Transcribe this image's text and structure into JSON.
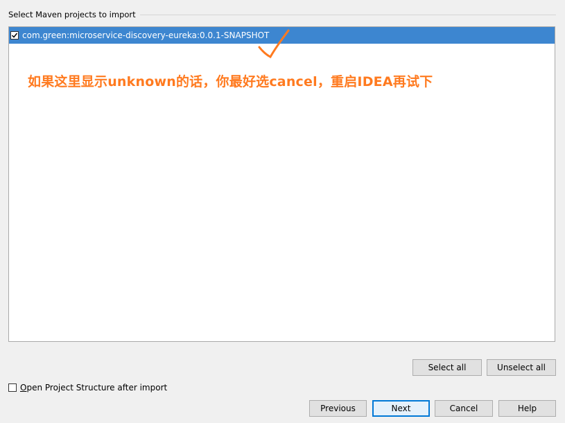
{
  "group": {
    "title": "Select Maven projects to import"
  },
  "projects": [
    {
      "label": "com.green:microservice-discovery-eureka:0.0.1-SNAPSHOT",
      "checked": true
    }
  ],
  "annotation": {
    "text": "如果这里显示unknown的话，你最好选cancel，重启IDEA再试下",
    "color": "#ff7a1f"
  },
  "buttons": {
    "select_all": "Select all",
    "unselect_all": "Unselect all",
    "previous": "Previous",
    "next": "Next",
    "cancel": "Cancel",
    "help": "Help"
  },
  "option": {
    "open_structure_mnemonic": "O",
    "open_structure_rest": "pen Project Structure after import",
    "checked": false
  },
  "colors": {
    "selection": "#3d86d0",
    "annotation": "#ff7a1f",
    "default_button_border": "#0078d7"
  }
}
